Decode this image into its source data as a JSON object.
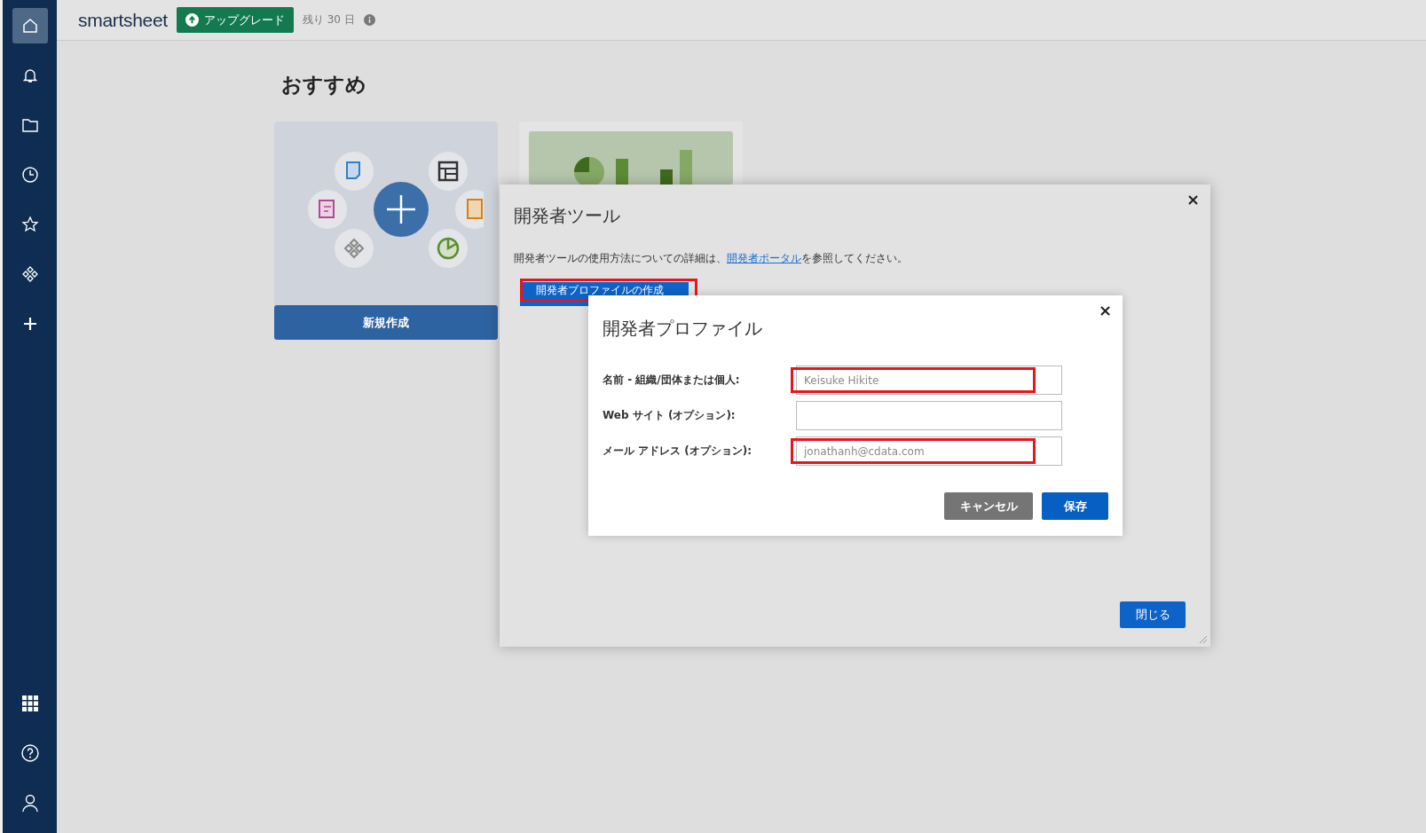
{
  "sidebar": {
    "top_items": [
      {
        "selected": true
      },
      {
        "selected": false
      },
      {
        "selected": false
      },
      {
        "selected": false
      },
      {
        "selected": false
      },
      {
        "selected": false
      },
      {
        "selected": false
      }
    ]
  },
  "header": {
    "logo": "smartsheet",
    "upgrade_button": "アップグレード",
    "trial": "残り 30 日"
  },
  "page": {
    "title": "おすすめ",
    "cards": [
      {
        "kind": "create",
        "button": "新規作成"
      },
      {
        "kind": "chart"
      }
    ]
  },
  "developer_tools_dialog": {
    "close_icon": "×",
    "title": "開発者ツール",
    "description": {
      "before": "開発者ツールの使用方法についての詳細は、",
      "link": "開発者ポータル",
      "after": "を参照してください。"
    },
    "create_button": {
      "label": "開発者プロファイルの作成",
      "highlighted": true
    },
    "close_button": "閉じる"
  },
  "profile_dialog": {
    "close_icon": "×",
    "title": "開発者プロファイル",
    "fields": [
      {
        "label": "名前 - 組織/団体または個人:",
        "value": "Keisuke Hikite",
        "highlighted": true
      },
      {
        "label": "Web サイト (オプション):",
        "highlighted": false
      },
      {
        "label": "メール アドレス (オプション):",
        "value": "jonathanh@cdata.com",
        "highlighted": true
      }
    ],
    "cancel_button": "キャンセル",
    "save_button": "保存"
  }
}
